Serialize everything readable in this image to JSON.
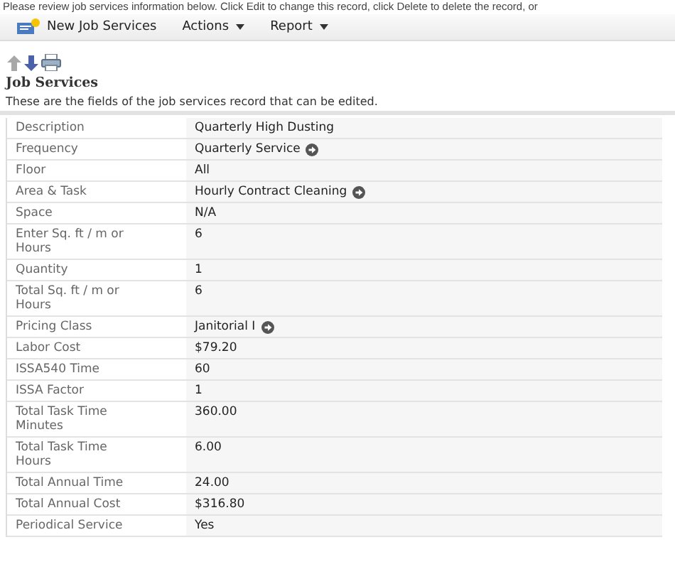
{
  "notice": "Please review job services information below. Click Edit to change this record, click Delete to delete the record, or",
  "toolbar": [
    {
      "kind": "new",
      "label": "New Job Services"
    },
    {
      "kind": "menu",
      "label": "Actions"
    },
    {
      "kind": "menu",
      "label": "Report"
    }
  ],
  "section": {
    "title": "Job Services",
    "description": "These are the fields of the job services record that can be edited."
  },
  "fields": [
    {
      "label": "Description",
      "value": "Quarterly High Dusting",
      "link": false
    },
    {
      "label": "Frequency",
      "value": "Quarterly Service",
      "link": true
    },
    {
      "label": "Floor",
      "value": "All",
      "link": false
    },
    {
      "label": "Area & Task",
      "value": "Hourly Contract Cleaning",
      "link": true
    },
    {
      "label": "Space",
      "value": "N/A",
      "link": false
    },
    {
      "label": "Enter Sq. ft / m or Hours",
      "value": "6",
      "link": false
    },
    {
      "label": "Quantity",
      "value": "1",
      "link": false
    },
    {
      "label": "Total Sq. ft / m or Hours",
      "value": "6",
      "link": false
    },
    {
      "label": "Pricing Class",
      "value": "Janitorial I",
      "link": true
    },
    {
      "label": "Labor Cost",
      "value": "$79.20",
      "link": false
    },
    {
      "label": "ISSA540 Time",
      "value": "60",
      "link": false
    },
    {
      "label": "ISSA Factor",
      "value": "1",
      "link": false
    },
    {
      "label": "Total Task Time Minutes",
      "value": "360.00",
      "link": false
    },
    {
      "label": "Total Task Time Hours",
      "value": "6.00",
      "link": false
    },
    {
      "label": "Total Annual Time",
      "value": "24.00",
      "link": false
    },
    {
      "label": "Total Annual Cost",
      "value": "$316.80",
      "link": false
    },
    {
      "label": "Periodical Service",
      "value": "Yes",
      "link": false
    }
  ]
}
